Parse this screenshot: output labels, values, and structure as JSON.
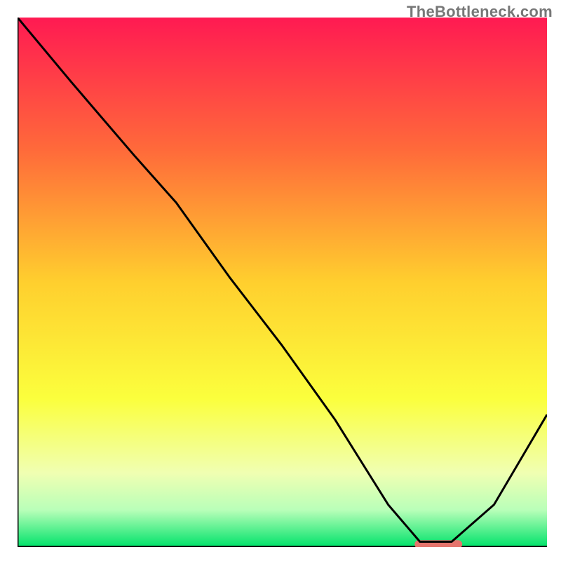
{
  "watermark": "TheBottleneck.com",
  "chart_data": {
    "type": "line",
    "title": "",
    "xlabel": "",
    "ylabel": "",
    "xlim": [
      0,
      100
    ],
    "ylim": [
      0,
      100
    ],
    "gradient_stops": [
      {
        "offset": 0,
        "color": "#ff1a52"
      },
      {
        "offset": 25,
        "color": "#ff6a3a"
      },
      {
        "offset": 50,
        "color": "#ffcf2e"
      },
      {
        "offset": 72,
        "color": "#fbff3d"
      },
      {
        "offset": 86,
        "color": "#f0ffb2"
      },
      {
        "offset": 93,
        "color": "#b9ffb9"
      },
      {
        "offset": 100,
        "color": "#00e26a"
      }
    ],
    "series": [
      {
        "name": "curve",
        "color": "#000000",
        "x": [
          0,
          10,
          22,
          30,
          40,
          50,
          60,
          70,
          76,
          82,
          90,
          100
        ],
        "y": [
          100,
          88,
          74,
          65,
          51,
          38,
          24,
          8,
          1,
          1,
          8,
          25
        ]
      }
    ],
    "marker": {
      "name": "optimal-marker",
      "x_start": 75,
      "x_end": 84,
      "y": 0.5,
      "color": "#e5746d"
    },
    "axes_color": "#000000"
  }
}
